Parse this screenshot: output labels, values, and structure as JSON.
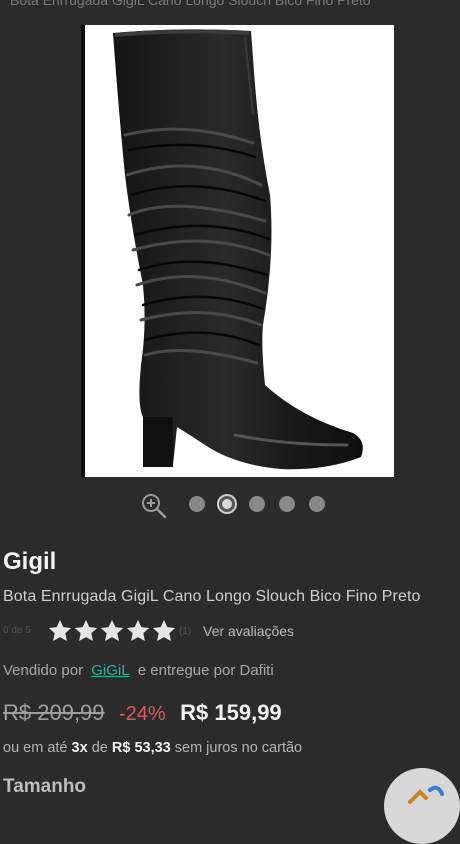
{
  "breadcrumb": "Bota Enrrugada GigiL Cano Longo Slouch Bico Fino Preto",
  "gallery": {
    "image_alt": "black-slouch-knee-boot",
    "dot_count": 5,
    "active_dot": 1
  },
  "product": {
    "brand": "Gigil",
    "name": "Bota Enrrugada GigiL Cano Longo Slouch Bico Fino Preto"
  },
  "rating": {
    "text": "0 de 5",
    "value": 5,
    "max": 5,
    "count": "(1)",
    "link_label": "Ver avaliações"
  },
  "seller": {
    "prefix": "Vendido por",
    "name": "GiGiL",
    "suffix": "e entregue por Dafiti"
  },
  "pricing": {
    "old_price": "R$ 209,99",
    "discount": "-24%",
    "price": "R$ 159,99",
    "installments_prefix": "ou em até",
    "installments_count": "3x",
    "installments_de": "de",
    "installments_value": "R$ 53,33",
    "installments_suffix": "sem juros no cartão"
  },
  "size_section": {
    "title": "Tamanho"
  },
  "colors": {
    "background": "#2b2b2b",
    "discount": "#e0575b",
    "seller_link": "#2bb597"
  }
}
